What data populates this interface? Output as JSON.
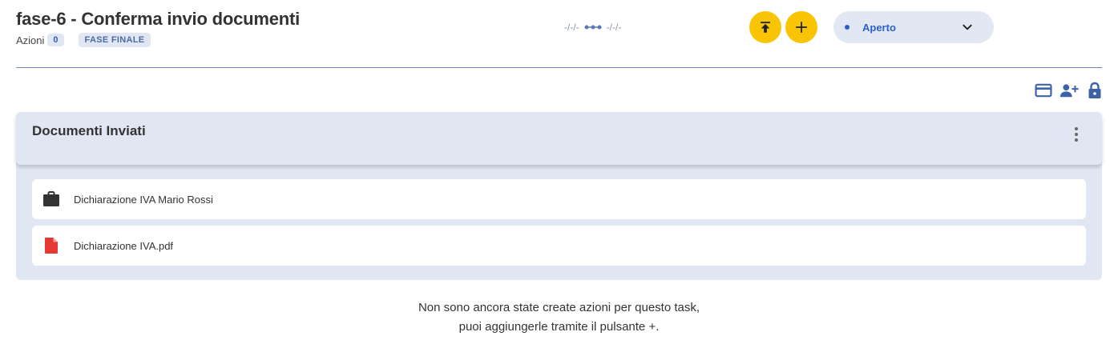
{
  "header": {
    "title": "fase-6 - Conferma invio documenti",
    "azioni_label": "Azioni",
    "azioni_count": "0",
    "phase_badge": "FASE FINALE",
    "start_date": "-/-/-",
    "end_date": "-/-/-",
    "upload_icon": "upload-to-top-icon",
    "add_icon": "plus-icon",
    "accent_color": "#f8c404"
  },
  "status": {
    "selected": "Aperto",
    "color": "#2b5fc9"
  },
  "toolbar": {
    "icons": [
      "credit-card-icon",
      "add-user-icon",
      "lock-icon"
    ]
  },
  "panel": {
    "title": "Documenti Inviati",
    "documents": [
      {
        "label": "Dichiarazione IVA Mario Rossi",
        "icon": "briefcase-icon"
      },
      {
        "label": "Dichiarazione IVA.pdf",
        "icon": "pdf-file-icon"
      }
    ]
  },
  "empty_state": {
    "line1": "Non sono ancora state create azioni per questo task,",
    "line2": "puoi aggiungerle tramite il pulsante +."
  }
}
